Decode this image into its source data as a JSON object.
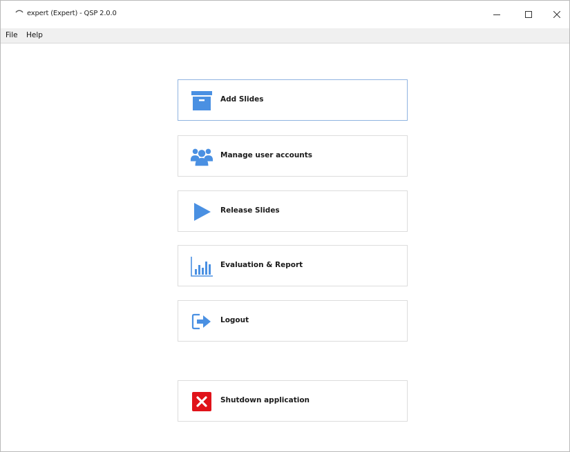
{
  "window": {
    "title": "expert (Expert) - QSP 2.0.0",
    "minimize_icon": "minimize-icon",
    "maximize_icon": "maximize-icon",
    "close_icon": "close-icon"
  },
  "menu": {
    "items": [
      {
        "label": "File"
      },
      {
        "label": "Help"
      }
    ]
  },
  "actions": [
    {
      "label": "Add Slides",
      "icon": "archive-box-icon",
      "color": "#4a90e2"
    },
    {
      "label": "Manage user accounts",
      "icon": "users-icon",
      "color": "#4a90e2"
    },
    {
      "label": "Release Slides",
      "icon": "play-icon",
      "color": "#4a90e2"
    },
    {
      "label": "Evaluation & Report",
      "icon": "bar-chart-icon",
      "color": "#4a90e2"
    },
    {
      "label": "Logout",
      "icon": "logout-icon",
      "color": "#4a90e2"
    },
    {
      "label": "Shutdown application",
      "icon": "shutdown-x-icon",
      "color": "#e0131a"
    }
  ]
}
